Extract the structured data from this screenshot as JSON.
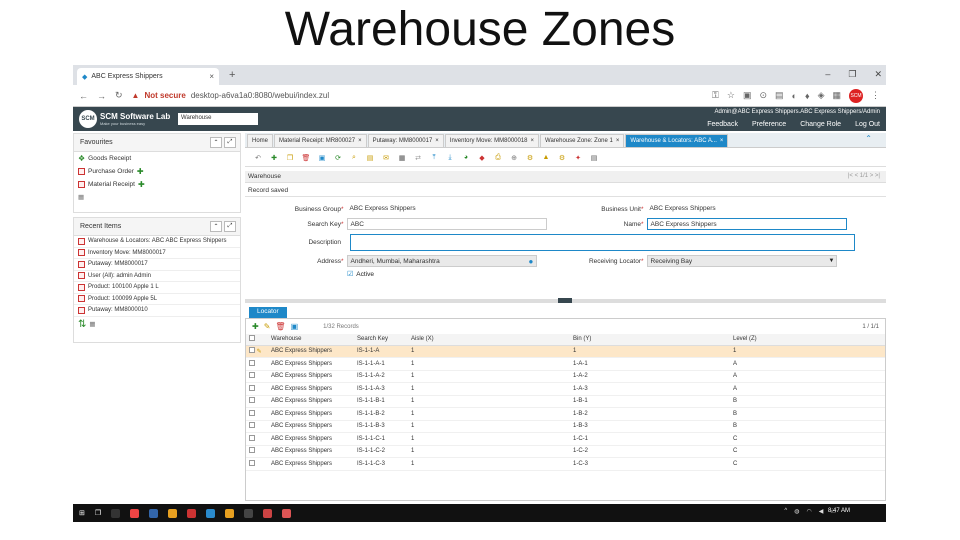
{
  "slide_title": "Warehouse Zones",
  "browser": {
    "tab_title": "ABC Express Shippers",
    "address_warning": "Not secure",
    "url": "desktop-a6va1a0:8080/webui/index.zul"
  },
  "app": {
    "logo_title": "SCM Software Lab",
    "logo_tagline": "Make your business easy",
    "search_value": "Warehouse",
    "user_line": "Admin@ABC Express Shippers.ABC Express Shippers/Admin",
    "links": [
      "Feedback",
      "Preference",
      "Change Role",
      "Log Out"
    ]
  },
  "favourites": {
    "title": "Favourites",
    "items": [
      "Goods Receipt",
      "Purchase Order",
      "Material Receipt"
    ]
  },
  "recent": {
    "title": "Recent Items",
    "items": [
      "Warehouse & Locators: ABC ABC Express Shippers",
      "Inventory Move: MM8000017",
      "Putaway: MM8000017",
      "User (All): admin Admin",
      "Product: 100100 Apple 1 L",
      "Product: 100099 Apple 5L",
      "Putaway: MM8000010"
    ]
  },
  "window_tabs": [
    "Home",
    "Material Receipt: MR800027",
    "Putaway: MM8000017",
    "Inventory Move: MM8000018",
    "Warehouse Zone: Zone 1",
    "Warehouse & Locators: ABC A..."
  ],
  "section_header": "Warehouse",
  "pager": "1/1",
  "status": "Record saved",
  "form": {
    "business_group_label": "Business Group",
    "business_group": "ABC Express Shippers",
    "business_unit_label": "Business Unit",
    "business_unit": "ABC Express Shippers",
    "search_key_label": "Search Key",
    "search_key": "ABC",
    "name_label": "Name",
    "name": "ABC Express Shippers",
    "description_label": "Description",
    "description": "",
    "address_label": "Address",
    "address": "Andheri, Mumbai, Maharashtra",
    "receiving_label": "Receiving Locator",
    "receiving": "Receiving Bay",
    "active_label": "Active"
  },
  "locator": {
    "tab_label": "Locator",
    "record_count": "1/32 Records",
    "page_info": "1 / 1/1",
    "columns": [
      "Warehouse",
      "Search Key",
      "Aisle (X)",
      "Bin (Y)",
      "Level (Z)"
    ],
    "rows": [
      [
        "ABC Express Shippers",
        "IS-1-1-A",
        "1",
        "1",
        "1"
      ],
      [
        "ABC Express Shippers",
        "IS-1-1-A-1",
        "1",
        "1-A-1",
        "A"
      ],
      [
        "ABC Express Shippers",
        "IS-1-1-A-2",
        "1",
        "1-A-2",
        "A"
      ],
      [
        "ABC Express Shippers",
        "IS-1-1-A-3",
        "1",
        "1-A-3",
        "A"
      ],
      [
        "ABC Express Shippers",
        "IS-1-1-B-1",
        "1",
        "1-B-1",
        "B"
      ],
      [
        "ABC Express Shippers",
        "IS-1-1-B-2",
        "1",
        "1-B-2",
        "B"
      ],
      [
        "ABC Express Shippers",
        "IS-1-1-B-3",
        "1",
        "1-B-3",
        "B"
      ],
      [
        "ABC Express Shippers",
        "IS-1-1-C-1",
        "1",
        "1-C-1",
        "C"
      ],
      [
        "ABC Express Shippers",
        "IS-1-1-C-2",
        "1",
        "1-C-2",
        "C"
      ],
      [
        "ABC Express Shippers",
        "IS-1-1-C-3",
        "1",
        "1-C-3",
        "C"
      ]
    ]
  },
  "taskbar": {
    "clock": "8:47 AM"
  },
  "colors": {
    "header": "#37474f",
    "accent": "#1e88c8",
    "selected_row": "#fde7c8"
  }
}
